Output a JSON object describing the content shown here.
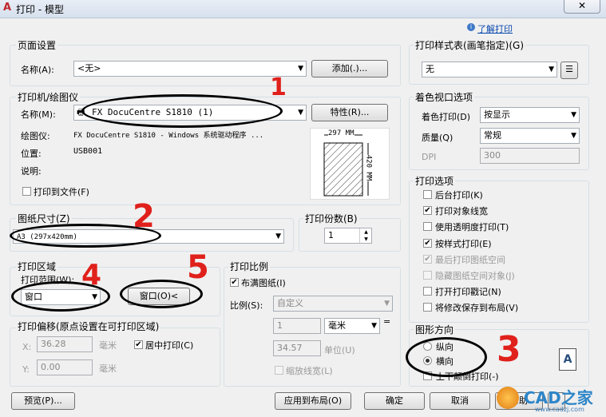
{
  "window": {
    "title": "打印 - 模型",
    "help_link": "了解打印"
  },
  "page_setup": {
    "group": "页面设置",
    "name_label": "名称(A):",
    "name_value": "<无>",
    "add_button": "添加(.)..."
  },
  "plotter": {
    "group": "打印机/绘图仪",
    "name_label": "名称(M):",
    "name_value": "FX DocuCentre S1810 (1)",
    "properties_button": "特性(R)...",
    "plotter_label": "绘图仪:",
    "plotter_value": "FX DocuCentre S1810 - Windows 系统驱动程序 ...",
    "location_label": "位置:",
    "location_value": "USB001",
    "description_label": "说明:",
    "print_to_file": "打印到文件(F)",
    "preview_width": "297 MM",
    "preview_height": "420 MM"
  },
  "paper": {
    "group": "图纸尺寸(Z)",
    "value": "A3 (297x420mm)"
  },
  "copies": {
    "group": "打印份数(B)",
    "value": "1"
  },
  "plot_area": {
    "group": "打印区域",
    "range_label": "打印范围(W):",
    "range_value": "窗口",
    "window_button": "窗口(O)<"
  },
  "plot_offset": {
    "group": "打印偏移(原点设置在可打印区域)",
    "x_label": "X:",
    "x_value": "36.28",
    "x_unit": "毫米",
    "y_label": "Y:",
    "y_value": "0.00",
    "y_unit": "毫米",
    "center_plot": "居中打印(C)"
  },
  "plot_scale": {
    "group": "打印比例",
    "fit_paper": "布满图纸(I)",
    "scale_label": "比例(S):",
    "scale_value": "自定义",
    "value1": "1",
    "unit1": "毫米",
    "value2": "34.57",
    "unit2": "单位(U)",
    "scale_lineweights": "缩放线宽(L)"
  },
  "plot_style_table": {
    "group": "打印样式表(画笔指定)(G)",
    "value": "无"
  },
  "shaded_viewport": {
    "group": "着色视口选项",
    "shade_label": "着色打印(D)",
    "shade_value": "按显示",
    "quality_label": "质量(Q)",
    "quality_value": "常规",
    "dpi_label": "DPI",
    "dpi_value": "300"
  },
  "plot_options": {
    "group": "打印选项",
    "items": [
      {
        "label": "后台打印(K)",
        "checked": false,
        "disabled": false
      },
      {
        "label": "打印对象线宽",
        "checked": true,
        "disabled": false
      },
      {
        "label": "使用透明度打印(T)",
        "checked": false,
        "disabled": false
      },
      {
        "label": "按样式打印(E)",
        "checked": true,
        "disabled": false
      },
      {
        "label": "最后打印图纸空间",
        "checked": true,
        "disabled": true
      },
      {
        "label": "隐藏图纸空间对象(J)",
        "checked": false,
        "disabled": true
      },
      {
        "label": "打开打印戳记(N)",
        "checked": false,
        "disabled": false
      },
      {
        "label": "将修改保存到布局(V)",
        "checked": false,
        "disabled": false
      }
    ]
  },
  "orientation": {
    "group": "图形方向",
    "portrait": "纵向",
    "landscape": "横向",
    "upside_down": "上下颠倒打印(-)",
    "selected": "landscape"
  },
  "buttons": {
    "preview": "预览(P)...",
    "apply_layout": "应用到布局(O)",
    "ok": "确定",
    "cancel": "取消",
    "help": "帮助"
  },
  "annotations": {
    "n1": "1",
    "n2": "2",
    "n3": "3",
    "n4": "4",
    "n5": "5"
  },
  "watermark": {
    "brand": "CAD之家",
    "url": "www.cadzj.com"
  }
}
